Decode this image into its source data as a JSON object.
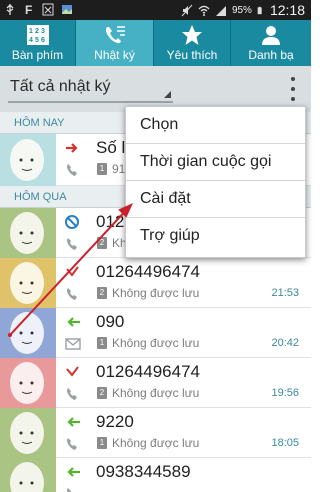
{
  "status_bar": {
    "battery": "95%",
    "time": "12:18"
  },
  "tabs": [
    {
      "label": "Bàn phím",
      "icon": "dialpad-icon",
      "active": false
    },
    {
      "label": "Nhật ký",
      "icon": "call-log-icon",
      "active": true
    },
    {
      "label": "Yêu thích",
      "icon": "star-icon",
      "active": false
    },
    {
      "label": "Danh bạ",
      "icon": "contact-icon",
      "active": false
    }
  ],
  "filter": {
    "selected": "Tất cả nhật ký"
  },
  "sections": {
    "today": "HÔM NAY",
    "yesterday": "HÔM QUA"
  },
  "rows": [
    {
      "name": "Số l",
      "sim": "1",
      "status": "91",
      "time": "",
      "call_type": "outgoing"
    },
    {
      "name": "012",
      "sim": "2",
      "status": "Kh",
      "time": "",
      "call_type": "rejected"
    },
    {
      "name": "01264496474",
      "sim": "2",
      "status": "Không được lưu",
      "time": "21:53",
      "call_type": "missed"
    },
    {
      "name": "090",
      "sim": "1",
      "status": "Không được lưu",
      "time": "20:42",
      "call_type": "incoming"
    },
    {
      "name": "01264496474",
      "sim": "2",
      "status": "Không được lưu",
      "time": "19:56",
      "call_type": "missed"
    },
    {
      "name": "9220",
      "sim": "1",
      "status": "Không được lưu",
      "time": "18:05",
      "call_type": "incoming"
    },
    {
      "name": "0938344589",
      "sim": "",
      "status": "",
      "time": "",
      "call_type": "incoming"
    }
  ],
  "menu": {
    "items": [
      "Chọn",
      "Thời gian cuộc gọi",
      "Cài đặt",
      "Trợ giúp"
    ]
  },
  "colors": {
    "accent": "#1a8aa0",
    "active_tab": "#46b1c5",
    "annotation": "#cc1f2a"
  }
}
